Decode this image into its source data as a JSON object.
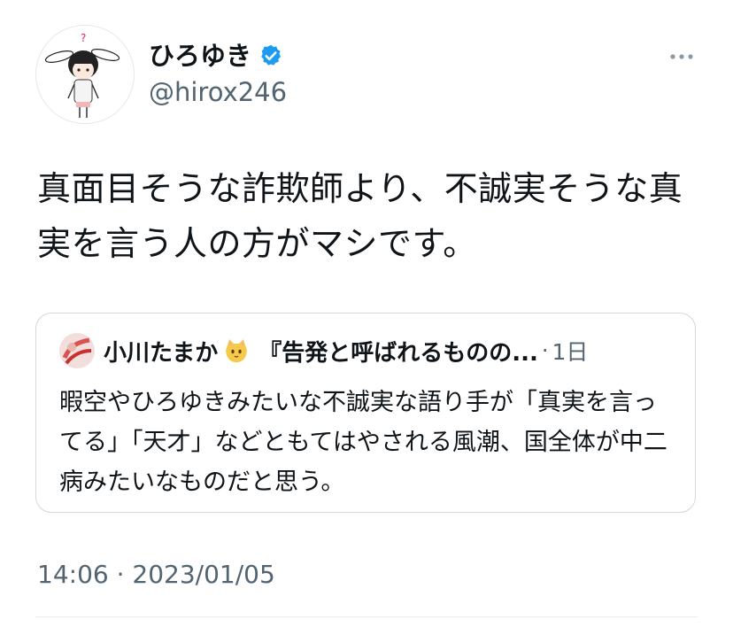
{
  "author": {
    "display_name": "ひろゆき",
    "handle": "@hirox246",
    "verified_icon": "verified-badge-icon",
    "accent_color": "#1d9bf0"
  },
  "tweet": {
    "text": "真面目そうな詐欺師より、不誠実そうな真実を言う人の方がマシです。",
    "timestamp": "14:06 · 2023/01/05"
  },
  "quoted_tweet": {
    "author_name": "小川たまか",
    "author_emoji": "cat-face-icon",
    "title": "『告発と呼ばれるものの...",
    "separator": "·",
    "time": "1日",
    "text": "暇空やひろゆきみたいな不誠実な語り手が「真実を言ってる」「天才」などともてはやされる風潮、国全体が中二病みたいなものだと思う。"
  },
  "more_icon": "more-horizontal-icon"
}
